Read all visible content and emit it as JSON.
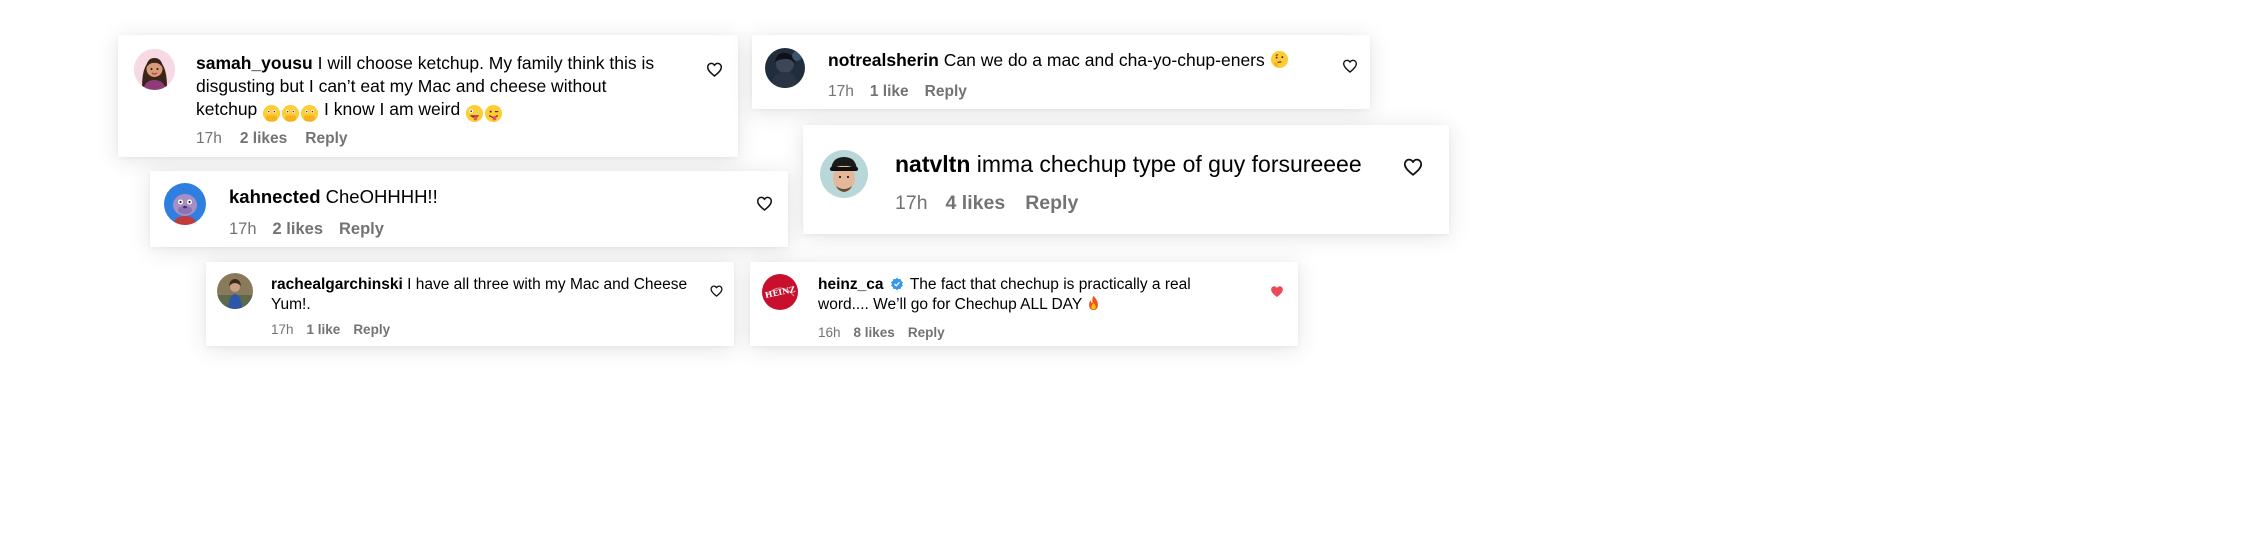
{
  "comments": [
    {
      "id": "c1",
      "username": "samah_yousu",
      "text_line1": "I will choose ketchup. My family think this is",
      "text_line2": "disgusting but I can’t eat my Mac and cheese without",
      "text_line3": "ketchup",
      "text_line3b": "I know I am weird",
      "emoji_set1": [
        "flushed-hands-face",
        "flushed-hands-face",
        "flushed-hands-face"
      ],
      "emoji_set2": [
        "zany-face",
        "winking-tongue-face"
      ],
      "time": "17h",
      "likes": "2 likes",
      "reply": "Reply",
      "liked": false
    },
    {
      "id": "c2",
      "username": "notrealsherin",
      "text": "Can we do a mac and cha-yo-chup-eners",
      "emoji": "thinking-face",
      "time": "17h",
      "likes": "1 like",
      "reply": "Reply",
      "liked": false
    },
    {
      "id": "c3",
      "username": "natvltn",
      "text": "imma chechup type of guy forsureeee",
      "time": "17h",
      "likes": "4 likes",
      "reply": "Reply",
      "liked": false
    },
    {
      "id": "c4",
      "username": "kahnected",
      "text": "CheOHHHH!!",
      "time": "17h",
      "likes": "2 likes",
      "reply": "Reply",
      "liked": false
    },
    {
      "id": "c5",
      "username": "rachealgarchinski",
      "text_line1": "I have all three with my Mac and Cheese",
      "text_line2": "Yum!.",
      "time": "17h",
      "likes": "1 like",
      "reply": "Reply",
      "liked": false
    },
    {
      "id": "c6",
      "username": "heinz_ca",
      "verified": true,
      "avatar_logo_text": "HEINZ",
      "text_line1": "The fact that chechup is practically a real",
      "text_line2": "word.... We’ll go for Chechup ALL DAY",
      "emoji": "fire",
      "time": "16h",
      "likes": "8 likes",
      "reply": "Reply",
      "liked": true
    }
  ],
  "colors": {
    "meta_gray": "#737373",
    "liked_heart": "#ed4956",
    "verified_blue": "#3897f0",
    "heinz_red": "#c8102e"
  }
}
